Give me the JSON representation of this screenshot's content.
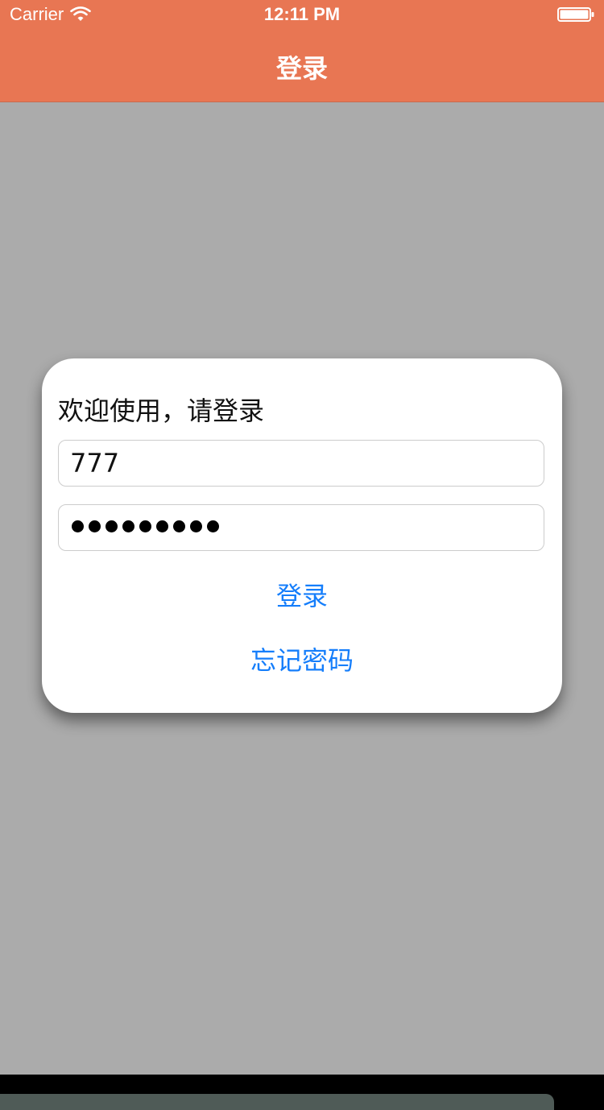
{
  "status_bar": {
    "carrier": "Carrier",
    "time": "12:11 PM",
    "wifi_icon": "wifi-icon",
    "battery_icon": "battery-icon"
  },
  "nav": {
    "title": "登录"
  },
  "dialog": {
    "title": "欢迎使用，请登录",
    "username": {
      "value": "777"
    },
    "password": {
      "masked_length": 9
    },
    "login_label": "登录",
    "forgot_label": "忘记密码"
  },
  "colors": {
    "header": "#e87653",
    "overlay": "#ababab",
    "link": "#157efb"
  }
}
